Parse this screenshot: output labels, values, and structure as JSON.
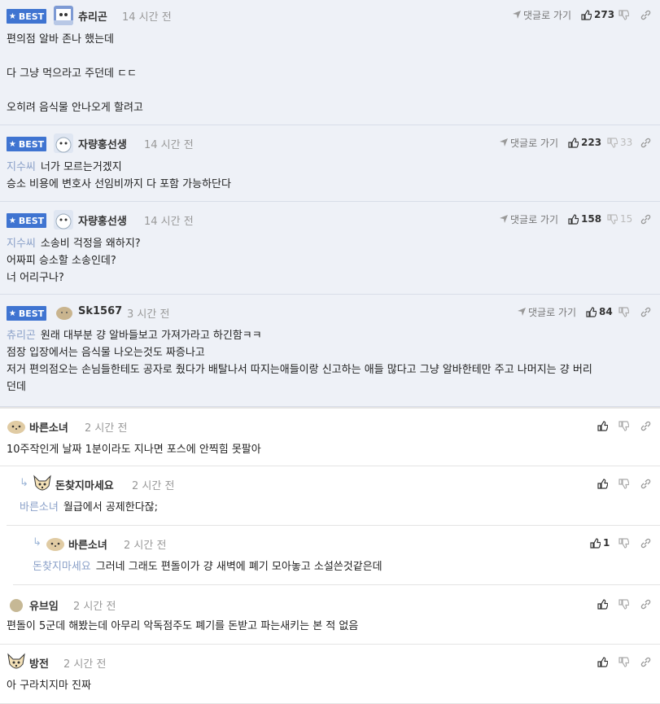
{
  "best_label": "BEST",
  "go_reply_label": "댓글로 가기",
  "comments": [
    {
      "nick": "츄리곤",
      "time": "14 시간 전",
      "likes": "273",
      "dislikes": "",
      "lines": [
        "편의점 알바 존나 했는데",
        "",
        "다 그냥 먹으라고 주던데 ㄷㄷ",
        "",
        "오히려 음식물 안나오게 할려고"
      ],
      "tag": ""
    },
    {
      "nick": "자량홍선생",
      "time": "14 시간 전",
      "likes": "223",
      "dislikes": "33",
      "tag": "지수씨",
      "lines": [
        "너가 모르는거겠지",
        "승소 비용에 변호사 선임비까지 다 포함 가능하단다"
      ]
    },
    {
      "nick": "자량홍선생",
      "time": "14 시간 전",
      "likes": "158",
      "dislikes": "15",
      "tag": "지수씨",
      "lines": [
        "소송비 걱정을 왜하지?",
        "어짜피 승소할 소송인데?",
        "너 어리구나?"
      ]
    },
    {
      "nick": "Sk1567",
      "time": "3 시간 전",
      "likes": "84",
      "dislikes": "",
      "tag": "츄리곤",
      "lines": [
        "원래 대부분 걍 알바들보고 가져가라고 하긴함ㅋㅋ",
        "점장 입장에서는 음식물 나오는것도 짜증나고",
        "저거 편의점오는 손님들한테도 공자로 줬다가 배탈나서 따지는애들이랑 신고하는 애들 많다고 그냥 알바한테만 주고 나머지는 걍 버리",
        "던데"
      ]
    },
    {
      "nick": "바른소녀",
      "time": "2 시간 전",
      "likes": "",
      "dislikes": "",
      "tag": "",
      "lines": [
        "10주작인게 날짜 1분이라도 지나면 포스에 안찍힘 못팔아"
      ]
    },
    {
      "nick": "돈찾지마세요",
      "time": "2 시간 전",
      "likes": "",
      "dislikes": "",
      "tag": "바른소녀",
      "lines": [
        "월급에서 공제한다잖;"
      ]
    },
    {
      "nick": "바른소녀",
      "time": "2 시간 전",
      "likes": "1",
      "dislikes": "",
      "tag": "돈찾지마세요",
      "lines": [
        "그러네 그래도 편돌이가 걍 새벽에 폐기 모아놓고 소설쓴것같은데"
      ]
    },
    {
      "nick": "유브임",
      "time": "2 시간 전",
      "likes": "",
      "dislikes": "",
      "tag": "",
      "lines": [
        "편돌이 5군데 해봤는데 아무리 악독점주도 폐기를 돈받고 파는새키는 본 적 없음"
      ]
    },
    {
      "nick": "방전",
      "time": "2 시간 전",
      "likes": "",
      "dislikes": "",
      "tag": "",
      "lines": [
        "아 구라치지마 진짜"
      ]
    }
  ],
  "colors": {
    "best_badge": "#3f74d1",
    "best_bg": "#eef1f7",
    "tag": "#8aa0c8"
  }
}
